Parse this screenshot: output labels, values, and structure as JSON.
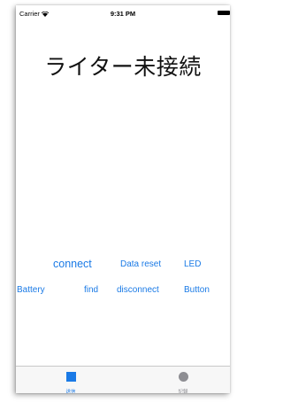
{
  "status_bar": {
    "carrier": "Carrier",
    "time": "9:31 PM"
  },
  "main": {
    "title": "ライター未接続",
    "buttons": {
      "connect": "connect",
      "data_reset": "Data reset",
      "led": "LED",
      "battery": "Battery",
      "find": "find",
      "disconnect": "disconnect",
      "button": "Button"
    }
  },
  "tab_bar": {
    "tabs": [
      {
        "label": "送信",
        "icon": "square-icon",
        "selected": true
      },
      {
        "label": "記録",
        "icon": "circle-icon",
        "selected": false
      }
    ]
  },
  "colors": {
    "accent": "#1a7ae6",
    "inactive": "#8e8e93"
  }
}
